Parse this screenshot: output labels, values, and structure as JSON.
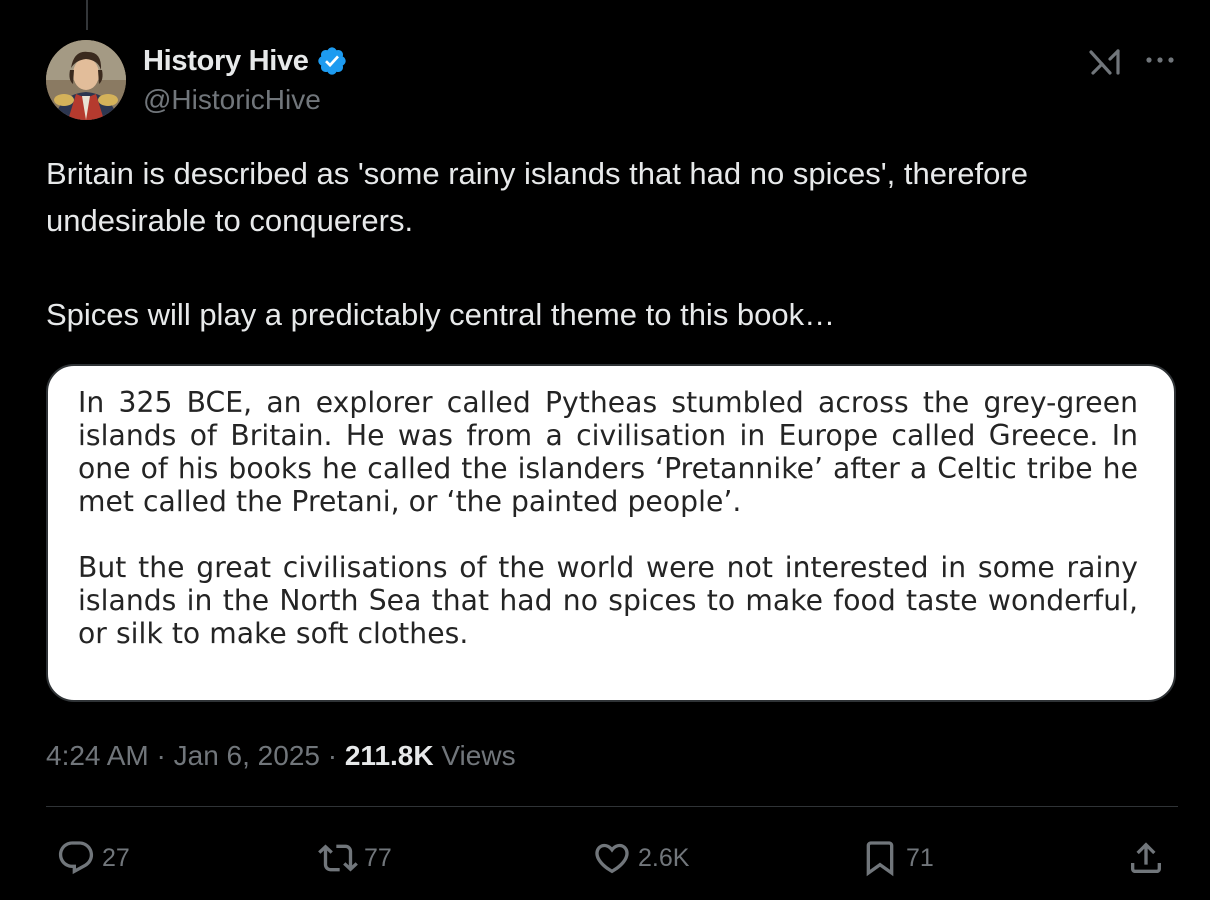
{
  "tweet": {
    "author": {
      "display_name": "History Hive",
      "handle": "@HistoricHive",
      "verified": true
    },
    "text": [
      "Britain is described as 'some rainy islands that had no spices', therefore undesirable to conquerers.",
      "Spices will play a predictably central theme to this book…"
    ],
    "media_text": [
      "In 325 BCE, an explorer called Pytheas stumbled across the grey-green islands of Britain. He was from a civilisation in Europe called Greece. In one of his books he called the islanders ‘Pretannike’ after a Celtic tribe he met called the Pretani, or ‘the painted people’.",
      "But the great civilisations of the world were not interested in some rainy islands in the North Sea that had no spices to make food taste wonderful, or silk to make soft clothes."
    ],
    "meta": {
      "time": "4:24 AM",
      "sep1": " · ",
      "date": "Jan 6, 2025",
      "sep2": " · ",
      "views_count": "211.8K",
      "views_label": " Views"
    },
    "actions": {
      "replies": "27",
      "reposts": "77",
      "likes": "2.6K",
      "bookmarks": "71"
    }
  },
  "icons": {
    "verified": "verified-badge-icon",
    "grok": "grok-icon",
    "more": "more-icon",
    "reply": "reply-icon",
    "repost": "repost-icon",
    "like": "heart-icon",
    "bookmark": "bookmark-icon",
    "share": "share-icon"
  },
  "colors": {
    "background": "#000000",
    "text_primary": "#e7e9ea",
    "text_secondary": "#71767b",
    "verified_blue": "#1d9bf0",
    "divider": "#2f3336"
  }
}
